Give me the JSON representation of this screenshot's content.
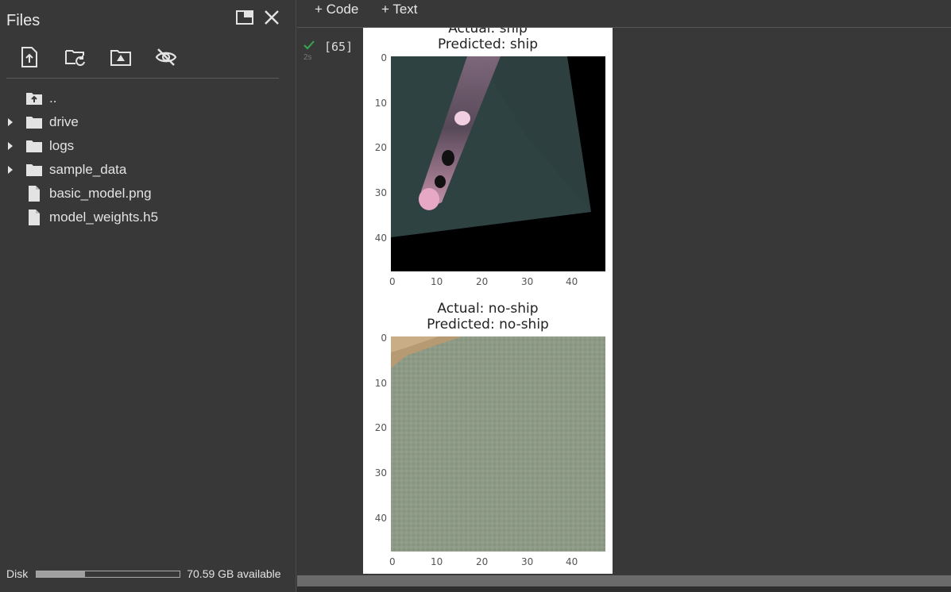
{
  "sidebar": {
    "title": "Files",
    "header_icons": [
      "panel-expand-icon",
      "close-icon"
    ],
    "toolbar_icons": [
      "upload-file-icon",
      "refresh-folder-icon",
      "mount-drive-icon",
      "hide-files-icon"
    ],
    "tree": [
      {
        "label": "..",
        "icon": "parent-folder-icon",
        "expandable": false
      },
      {
        "label": "drive",
        "icon": "folder-icon",
        "expandable": true
      },
      {
        "label": "logs",
        "icon": "folder-icon",
        "expandable": true
      },
      {
        "label": "sample_data",
        "icon": "folder-icon",
        "expandable": true
      },
      {
        "label": "basic_model.png",
        "icon": "file-icon",
        "expandable": false
      },
      {
        "label": "model_weights.h5",
        "icon": "file-icon",
        "expandable": false
      }
    ],
    "disk": {
      "label": "Disk",
      "used_fraction": 0.34,
      "available_text": "70.59 GB available"
    }
  },
  "topbar": {
    "add_code_label": "+ Code",
    "add_text_label": "+ Text"
  },
  "cell": {
    "execution_count": "[65]",
    "exec_time": "2s",
    "status": "success"
  },
  "plots": [
    {
      "title_line1": "Actual: ship",
      "title_line2": "Predicted: ship",
      "yticks": [
        "0",
        "10",
        "20",
        "30",
        "40"
      ],
      "xticks": [
        "0",
        "10",
        "20",
        "30",
        "40"
      ]
    },
    {
      "title_line1": "Actual: no-ship",
      "title_line2": "Predicted: no-ship",
      "yticks": [
        "0",
        "10",
        "20",
        "30",
        "40"
      ],
      "xticks": [
        "0",
        "10",
        "20",
        "30",
        "40"
      ]
    }
  ],
  "colors": {
    "sidebar_bg": "#383838",
    "success": "#34a853",
    "output_bg": "#ffffff"
  }
}
